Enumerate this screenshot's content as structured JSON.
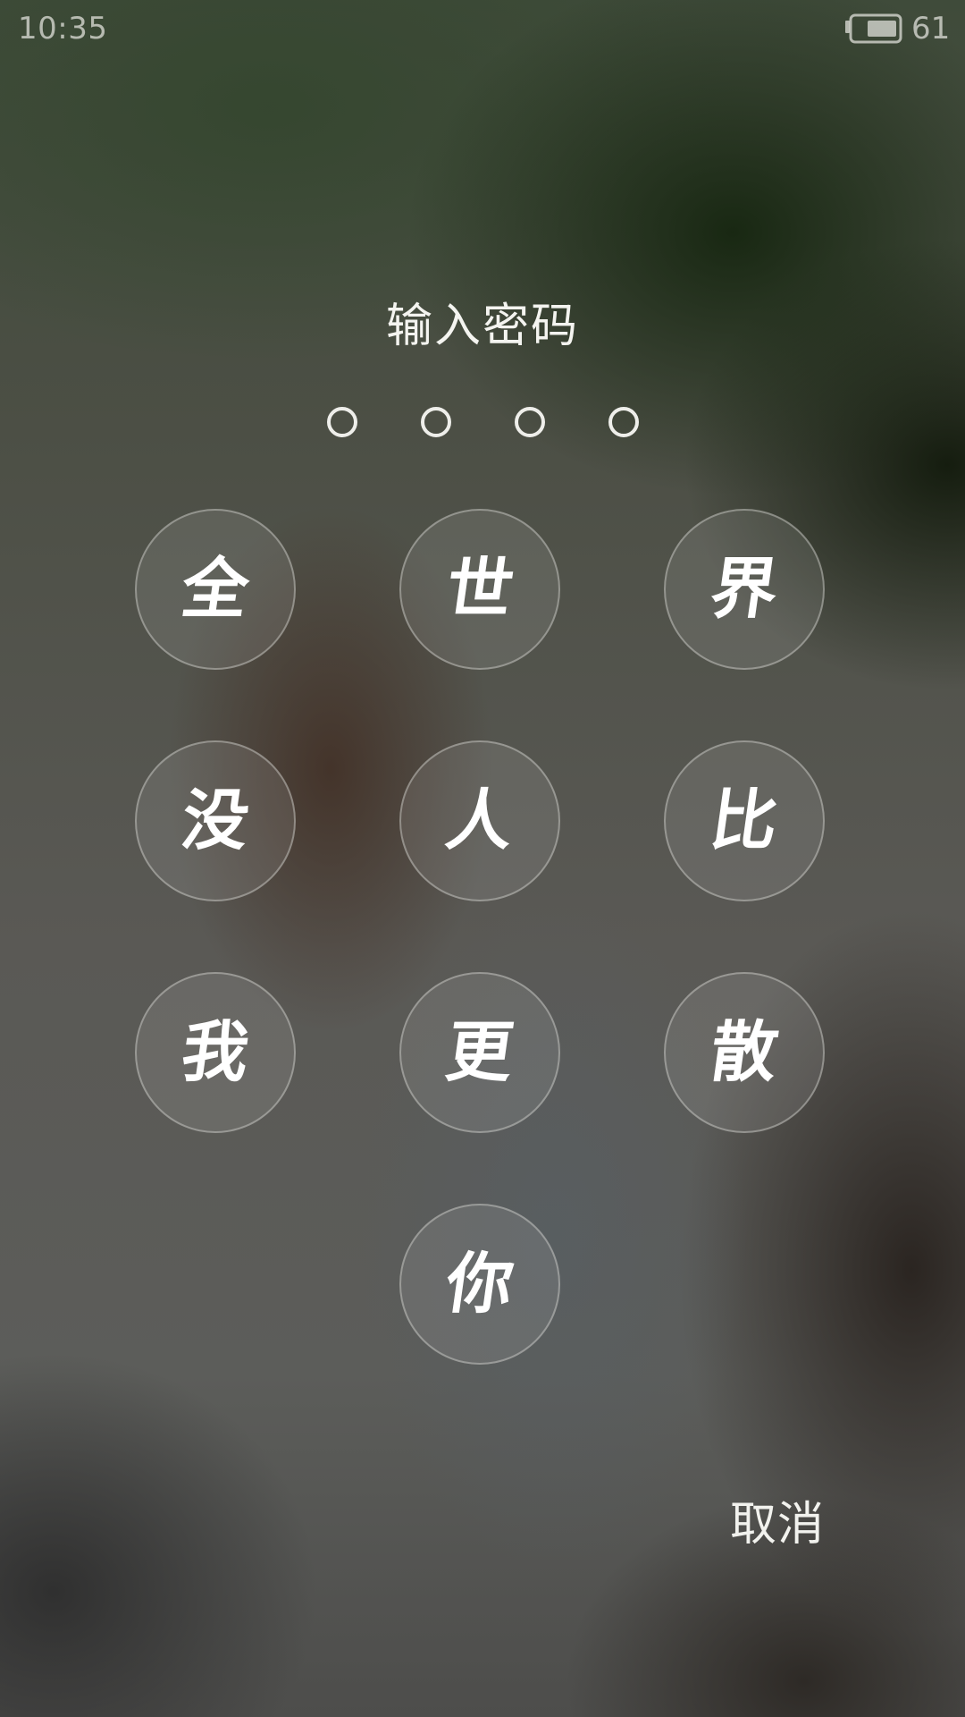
{
  "status_bar": {
    "time": "10:35",
    "battery_percent": "61",
    "battery_level": 0.61,
    "battery_icon": "battery-icon"
  },
  "lock_screen": {
    "title": "输入密码",
    "entered_digits": 0,
    "total_digits": 4,
    "keys": [
      "全",
      "世",
      "界",
      "没",
      "人",
      "比",
      "我",
      "更",
      "散",
      "你"
    ],
    "cancel_label": "取消"
  },
  "colors": {
    "text": "#f4f4f0",
    "key_border": "#dcdcd7",
    "indicator": "#eeeeea"
  }
}
